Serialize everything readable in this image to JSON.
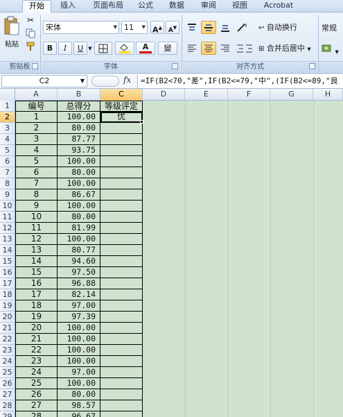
{
  "ribbon": {
    "tabs": [
      "开始",
      "插入",
      "页面布局",
      "公式",
      "数据",
      "审阅",
      "视图",
      "Acrobat"
    ],
    "active_tab": 0,
    "clipboard": {
      "paste_label": "粘贴",
      "group_label": "剪贴板"
    },
    "font": {
      "name": "宋体",
      "size": "11",
      "bold": "B",
      "italic": "I",
      "underline": "U",
      "font_color_letter": "A",
      "phonetic": "變",
      "grow": "A",
      "shrink": "A",
      "group_label": "字体"
    },
    "alignment": {
      "wrap_text": "自动换行",
      "merge_center": "合并后居中",
      "group_label": "对齐方式"
    },
    "number": {
      "format": "常规"
    },
    "colors": {
      "fill": "#f8e000",
      "font": "#d00000",
      "pressed": "#f9c96a"
    }
  },
  "formula_bar": {
    "name_box": "C2",
    "fx": "fx",
    "formula": "=IF(B2<70,\"差\",IF(B2<=79,\"中\",(IF(B2<=89,\"良"
  },
  "columns": [
    "A",
    "B",
    "C",
    "D",
    "E",
    "F",
    "G",
    "H"
  ],
  "row_numbers": [
    "1",
    "2",
    "3",
    "4",
    "5",
    "6",
    "7",
    "8",
    "9",
    "10",
    "11",
    "12",
    "13",
    "14",
    "15",
    "16",
    "17",
    "18",
    "19",
    "20",
    "21",
    "22",
    "23",
    "24",
    "25",
    "26",
    "27",
    "28",
    "29",
    "30"
  ],
  "sheet": {
    "headers": [
      "编号",
      "总得分",
      "等级评定"
    ],
    "rows": [
      [
        "1",
        "100.00",
        "优"
      ],
      [
        "2",
        "80.00",
        ""
      ],
      [
        "3",
        "87.77",
        ""
      ],
      [
        "4",
        "93.75",
        ""
      ],
      [
        "5",
        "100.00",
        ""
      ],
      [
        "6",
        "80.00",
        ""
      ],
      [
        "7",
        "100.00",
        ""
      ],
      [
        "8",
        "86.67",
        ""
      ],
      [
        "9",
        "100.00",
        ""
      ],
      [
        "10",
        "80.00",
        ""
      ],
      [
        "11",
        "81.99",
        ""
      ],
      [
        "12",
        "100.00",
        ""
      ],
      [
        "13",
        "80.77",
        ""
      ],
      [
        "14",
        "94.60",
        ""
      ],
      [
        "15",
        "97.50",
        ""
      ],
      [
        "16",
        "96.88",
        ""
      ],
      [
        "17",
        "82.14",
        ""
      ],
      [
        "18",
        "97.00",
        ""
      ],
      [
        "19",
        "97.39",
        ""
      ],
      [
        "20",
        "100.00",
        ""
      ],
      [
        "21",
        "100.00",
        ""
      ],
      [
        "22",
        "100.00",
        ""
      ],
      [
        "23",
        "100.00",
        ""
      ],
      [
        "24",
        "97.00",
        ""
      ],
      [
        "25",
        "100.00",
        ""
      ],
      [
        "26",
        "80.00",
        ""
      ],
      [
        "27",
        "98.57",
        ""
      ],
      [
        "28",
        "96.67",
        ""
      ],
      [
        "29",
        "100.00",
        ""
      ]
    ]
  }
}
